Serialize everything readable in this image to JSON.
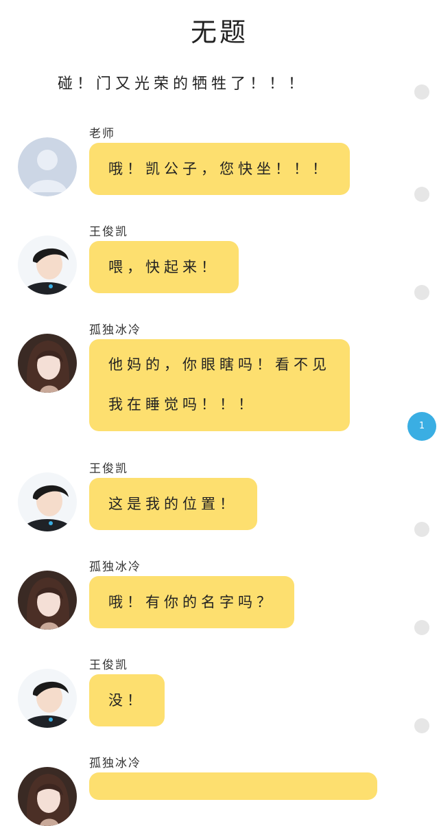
{
  "title": "无题",
  "narration": "碰！门又光荣的牺牲了！！！",
  "messages": [
    {
      "sender": "老师",
      "text": "哦！凯公子，您快坐！！！"
    },
    {
      "sender": "王俊凯",
      "text": "喂，快起来！"
    },
    {
      "sender": "孤独冰冷",
      "lines": [
        "他妈的，你眼瞎吗！看不见",
        "我在睡觉吗！！！"
      ]
    },
    {
      "sender": "王俊凯",
      "text": "这是我的位置！"
    },
    {
      "sender": "孤独冰冷",
      "text": "哦！有你的名字吗？"
    },
    {
      "sender": "王俊凯",
      "text": "没！"
    },
    {
      "sender": "孤独冰冷",
      "text": ""
    }
  ],
  "comment_badge": {
    "count": "1",
    "color": "#3aaee3"
  },
  "colors": {
    "bubble": "#fddf6f",
    "dot": "#e6e6e6",
    "background": "#ffffff"
  },
  "icons": {
    "teacher_avatar": "default-person-silhouette",
    "wangjunkai_avatar": "boy-portrait-photo",
    "gudubingleng_avatar": "girl-portrait-photo"
  }
}
